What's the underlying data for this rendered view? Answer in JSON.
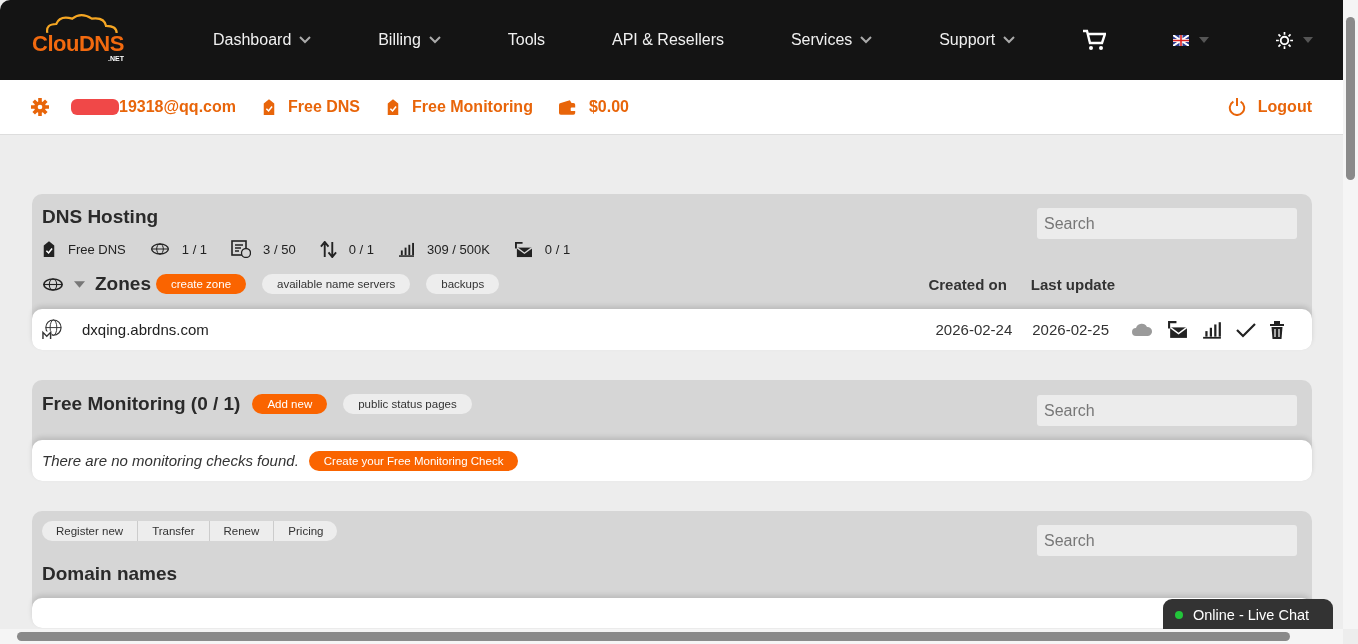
{
  "logo": {
    "text": "ClouDNS",
    "suffix": ".NET"
  },
  "nav": [
    {
      "label": "Dashboard",
      "dropdown": true
    },
    {
      "label": "Billing",
      "dropdown": true
    },
    {
      "label": "Tools",
      "dropdown": false
    },
    {
      "label": "API & Resellers",
      "dropdown": false
    },
    {
      "label": "Services",
      "dropdown": true
    },
    {
      "label": "Support",
      "dropdown": true
    }
  ],
  "user_bar": {
    "email": "19318@qq.com",
    "email_redacted": true,
    "plans": [
      "Free DNS",
      "Free Monitoring"
    ],
    "balance": "$0.00",
    "logout": "Logout"
  },
  "dns_hosting": {
    "title": "DNS Hosting",
    "search": {
      "placeholder": "Search"
    },
    "stats": [
      {
        "kind": "plan",
        "value": "Free DNS"
      },
      {
        "kind": "zones",
        "value": "1 / 1"
      },
      {
        "kind": "records",
        "value": "3 / 50"
      },
      {
        "kind": "transfers",
        "value": "0 / 1"
      },
      {
        "kind": "queries",
        "value": "309 / 500K"
      },
      {
        "kind": "mail",
        "value": "0 / 1"
      }
    ],
    "zones": {
      "title": "Zones",
      "expanded": true,
      "buttons": [
        {
          "label": "create zone",
          "primary": true
        },
        {
          "label": "available name servers",
          "primary": false
        },
        {
          "label": "backups",
          "primary": false
        }
      ],
      "columns": [
        "Created on",
        "Last update"
      ],
      "rows": [
        {
          "domain": "dxqing.abrdns.com",
          "created": "2026-02-24",
          "updated": "2026-02-25",
          "actions": [
            {
              "kind": "cloud",
              "disabled": true
            },
            {
              "kind": "mail",
              "disabled": false
            },
            {
              "kind": "stats",
              "disabled": false
            },
            {
              "kind": "check",
              "disabled": false
            },
            {
              "kind": "trash",
              "disabled": false
            }
          ]
        }
      ]
    }
  },
  "monitoring": {
    "title": "Free Monitoring (0 / 1)",
    "search": {
      "placeholder": "Search"
    },
    "buttons": [
      {
        "label": "Add new",
        "primary": true
      },
      {
        "label": "public status pages",
        "primary": false
      }
    ],
    "empty_text": "There are no monitoring checks found.",
    "create_button": "Create your Free Monitoring Check"
  },
  "domains": {
    "tabs": [
      "Register new",
      "Transfer",
      "Renew",
      "Pricing"
    ],
    "search": {
      "placeholder": "Search"
    },
    "title": "Domain names"
  },
  "chat": {
    "label": "Online - Live Chat",
    "online": true
  }
}
